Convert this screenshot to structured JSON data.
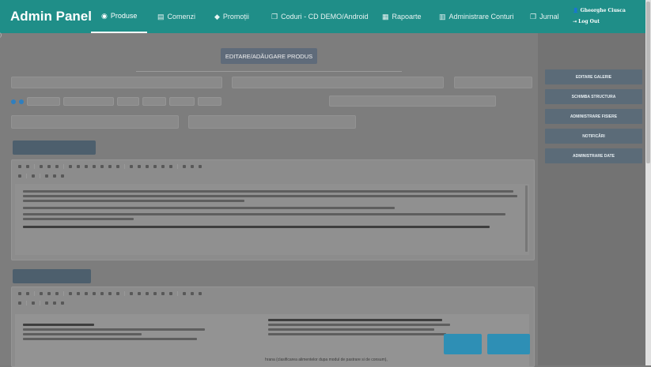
{
  "brand": "Admin Panel",
  "nav": [
    {
      "label": "Produse",
      "icon": "dashboard-icon",
      "glyph": "◉",
      "active": true
    },
    {
      "label": "Comenzi",
      "icon": "document-icon",
      "glyph": "▤",
      "active": false
    },
    {
      "label": "Promoții",
      "icon": "tag-icon",
      "glyph": "◆",
      "active": false
    },
    {
      "label": "Coduri - CD DEMO/Android",
      "icon": "copy-icon",
      "glyph": "❐",
      "active": false
    },
    {
      "label": "Rapoarte",
      "icon": "calendar-icon",
      "glyph": "▦",
      "active": false
    },
    {
      "label": "Administrare Conturi",
      "icon": "chart-icon",
      "glyph": "▥",
      "active": false
    },
    {
      "label": "Jurnal",
      "icon": "copy-icon",
      "glyph": "❐",
      "active": false
    }
  ],
  "user": {
    "name": "Gheorghe Ciusca",
    "logout": "Log Out",
    "user_glyph": "👤",
    "logout_glyph": "⇥"
  },
  "left_marker": ")",
  "page_title": "EDITARE/ADĂUGARE PRODUS",
  "sidebar": [
    {
      "label": "EDITARE GALERIE"
    },
    {
      "label": "SCHIMBA STRUCTURA"
    },
    {
      "label": "ADMINISTRARE FISIERE"
    },
    {
      "label": "NOTIFICĂRI"
    },
    {
      "label": "ADMINISTRARE DATE"
    }
  ],
  "colors": {
    "navbar": "#1f8e88",
    "overlay": "#7d7d7d",
    "sidebar_btn": "#5b6b78",
    "accent_btn": "#2e8fb5"
  },
  "bottom_text": "hrana (clasificarea alimentelor dupa modul de pastrare si de consum),"
}
